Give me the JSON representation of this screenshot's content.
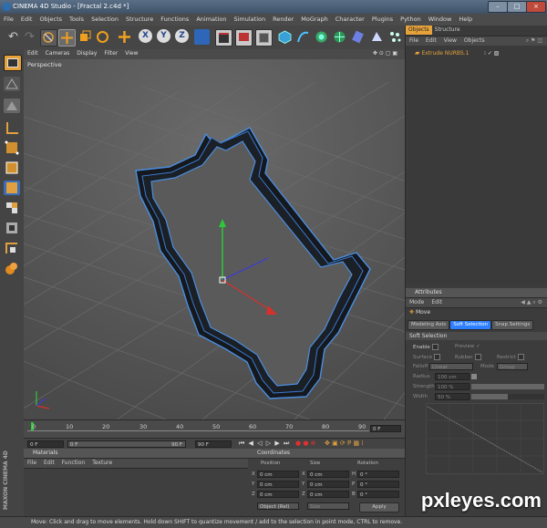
{
  "window": {
    "title": "CINEMA 4D Studio - [Fractal 2.c4d *]",
    "min": "–",
    "max": "□",
    "close": "×"
  },
  "menu": [
    "File",
    "Edit",
    "Objects",
    "Tools",
    "Selection",
    "Structure",
    "Functions",
    "Animation",
    "Simulation",
    "Render",
    "MoGraph",
    "Character",
    "Plugins",
    "Python",
    "Window",
    "Help"
  ],
  "viewport": {
    "menu": [
      "Edit",
      "Cameras",
      "Display",
      "Filter",
      "View"
    ],
    "label": "Perspective"
  },
  "timeline": {
    "ticks": [
      "0",
      "10",
      "20",
      "30",
      "40",
      "50",
      "60",
      "70",
      "80",
      "90"
    ],
    "current_frame": "0 F",
    "start": "0 F",
    "min_field": "0 F",
    "max_field": "90 F",
    "end": "90 F"
  },
  "materials": {
    "title": "Materials",
    "menu": [
      "File",
      "Edit",
      "Function",
      "Texture"
    ]
  },
  "coordinates": {
    "title": "Coordinates",
    "headers": [
      "Position",
      "Size",
      "Rotation"
    ],
    "rows": [
      {
        "axis": "X",
        "pos": "0 cm",
        "size_axis": "X",
        "size": "0 cm",
        "rot_axis": "H",
        "rot": "0 °"
      },
      {
        "axis": "Y",
        "pos": "0 cm",
        "size_axis": "Y",
        "size": "0 cm",
        "rot_axis": "P",
        "rot": "0 °"
      },
      {
        "axis": "Z",
        "pos": "0 cm",
        "size_axis": "Z",
        "size": "0 cm",
        "rot_axis": "B",
        "rot": "0 °"
      }
    ],
    "mode": "Object (Rel)",
    "size_mode": "Size",
    "apply": "Apply"
  },
  "objects_panel": {
    "tabs": [
      "Objects",
      "Structure"
    ],
    "menu": [
      "File",
      "Edit",
      "View",
      "Objects"
    ],
    "items": [
      {
        "name": "Extrude NURBS.1"
      }
    ]
  },
  "attributes": {
    "tab": "Attributes",
    "menu": [
      "Mode",
      "Edit"
    ],
    "tool": "Move",
    "subtabs": [
      "Modeling Axis",
      "Soft Selection",
      "Snap Settings"
    ],
    "section": "Soft Selection",
    "enable": "Enable",
    "preview": "Preview",
    "surface": "Surface",
    "rubber": "Rubber",
    "restrict": "Restrict",
    "falloff_label": "Falloff",
    "falloff": "Linear",
    "mode_label": "Mode",
    "mode": "Group",
    "radius_label": "Radius",
    "radius": "100 cm",
    "strength_label": "Strength",
    "strength": "100 %",
    "width_label": "Width",
    "width": "50 %"
  },
  "status": "Move: Click and drag to move elements. Hold down SHIFT to quantize movement / add to the selection in point mode, CTRL to remove.",
  "branding": {
    "side": "MAXON CINEMA 4D",
    "watermark": "pxleyes.com"
  },
  "colors": {
    "accent": "#e8a23a",
    "selection": "#2d7fff",
    "viewport_bg": "#5a5a5a"
  }
}
